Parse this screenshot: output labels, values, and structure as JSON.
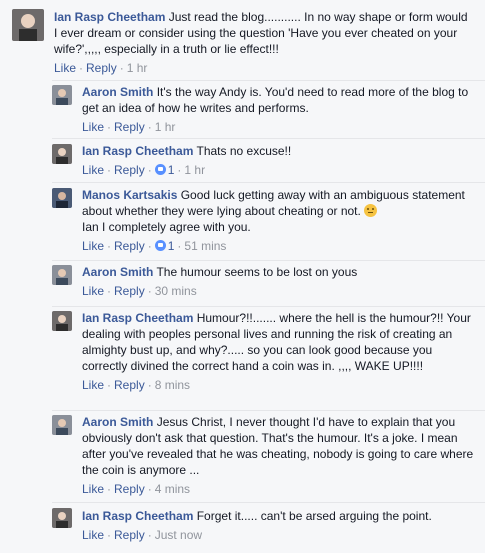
{
  "ui": {
    "like": "Like",
    "reply": "Reply",
    "separator": "·"
  },
  "comments": [
    {
      "author": "Ian Rasp Cheetham",
      "text": "Just read the blog........... In no way shape or form would I ever dream or consider using the question 'Have you ever cheated on your wife?',,,,, especially in a truth or lie effect!!!",
      "time": "1 hr",
      "likes": null
    },
    {
      "author": "Aaron Smith",
      "text": "It's the way Andy is. You'd need to read more of the blog to get an idea of how he writes and performs.",
      "time": "1 hr",
      "likes": null
    },
    {
      "author": "Ian Rasp Cheetham",
      "text": "Thats no excuse!!",
      "time": "1 hr",
      "likes": "1"
    },
    {
      "author": "Manos Kartsakis",
      "text": "Good luck getting away with an ambiguous statement about whether they were lying about cheating or not.",
      "text2": "Ian I completely agree with you.",
      "time": "51 mins",
      "likes": "1"
    },
    {
      "author": "Aaron Smith",
      "text": "The humour seems to be lost on yous",
      "time": "30 mins",
      "likes": null
    },
    {
      "author": "Ian Rasp Cheetham",
      "text": "Humour?!!....... where the hell is the humour?!! Your dealing with peoples personal lives and running the risk of creating an almighty bust up, and why?..... so you can look good because you correctly divined the correct hand a coin was in. ,,,, WAKE UP!!!!",
      "time": "8 mins",
      "likes": null
    },
    {
      "author": "Aaron Smith",
      "text": "Jesus Christ, I never thought I'd have to explain that you obviously don't ask that question. That's the humour. It's a joke. I mean after you've revealed that he was cheating, nobody is going to care where the coin is anymore ...",
      "time": "4 mins",
      "likes": null
    },
    {
      "author": "Ian Rasp Cheetham",
      "text": "Forget it..... can't be arsed arguing the point.",
      "time": "Just now",
      "likes": null
    }
  ]
}
